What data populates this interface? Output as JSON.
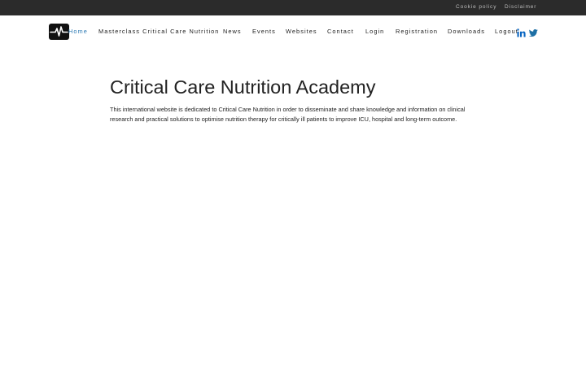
{
  "topbar": {
    "cookie_policy": "Cookie policy",
    "disclaimer": "Disclaimer"
  },
  "navbar": {
    "logo_icon": "heartbeat-icon",
    "items": [
      {
        "label": "Home",
        "active": true
      },
      {
        "label": "Masterclass Critical Care Nutrition"
      },
      {
        "label": "News"
      },
      {
        "label": "Events"
      },
      {
        "label": "Websites"
      },
      {
        "label": "Contact"
      },
      {
        "label": "Login"
      },
      {
        "label": "Registration"
      },
      {
        "label": "Downloads"
      },
      {
        "label": "Logout"
      }
    ],
    "social": [
      {
        "icon": "linkedin-icon",
        "color": "#0a66c2"
      },
      {
        "icon": "twitter-icon",
        "color": "#1d6fa5"
      }
    ]
  },
  "main": {
    "title": "Critical Care Nutrition Academy",
    "intro": "This international website is dedicated to Critical Care Nutrition in order to disseminate and share knowledge and information on clinical research and practical solutions to optimise nutrition therapy for critically ill patients to improve ICU, hospital and long-term outcome."
  },
  "colors": {
    "topbar_bg": "#2b2b2b",
    "accent": "#2e7bb4",
    "text": "#222222"
  }
}
